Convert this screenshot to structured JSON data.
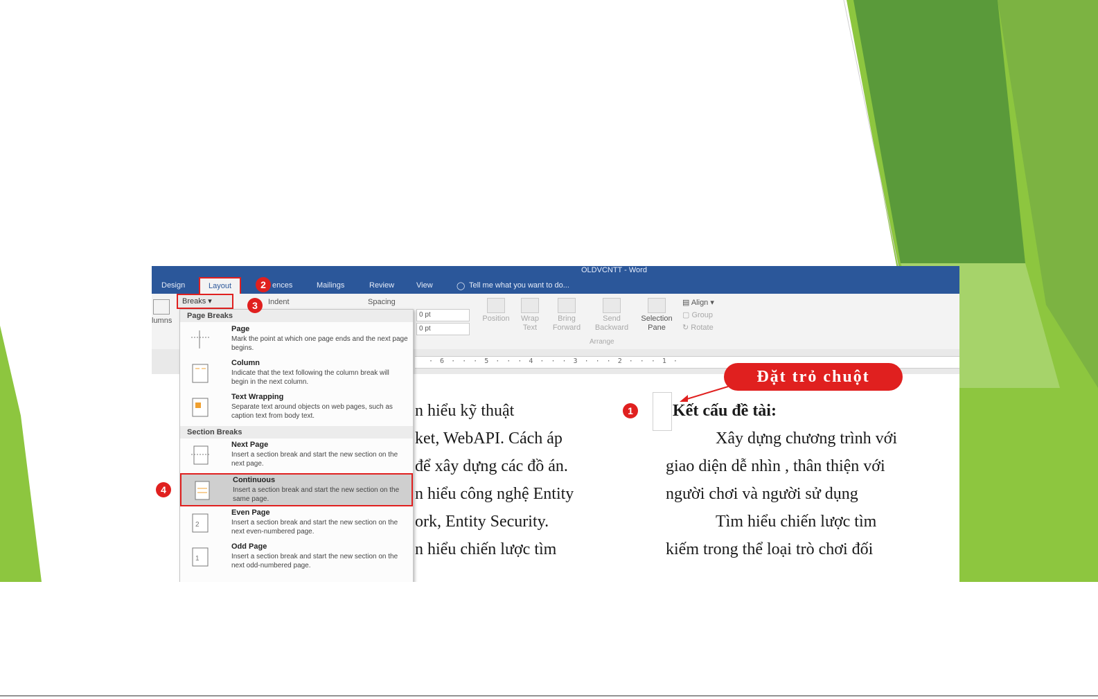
{
  "window_title": "OLDVCNTT - Word",
  "tabs": [
    "Design",
    "Layout",
    "ences",
    "Mailings",
    "Review",
    "View"
  ],
  "tell_me": "Tell me what you want to do...",
  "ribbon": {
    "columns_label": "lumns",
    "breaks_button": "Breaks",
    "indent_label": "Indent",
    "spacing_label": "Spacing",
    "spacing_before": "0 pt",
    "spacing_after": "0 pt",
    "position": "Position",
    "wrap_text": "Wrap Text",
    "bring_forward": "Bring Forward",
    "send_backward": "Send Backward",
    "selection_pane": "Selection Pane",
    "align": "Align",
    "group": "Group",
    "rotate": "Rotate",
    "arrange_group": "Arrange"
  },
  "ruler_numbers": "· 6 · · · 5 · · · 4 · · · 3 · · · 2 · · · 1 ·",
  "menu": {
    "page_breaks_header": "Page Breaks",
    "section_breaks_header": "Section Breaks",
    "items": [
      {
        "title": "Page",
        "desc": "Mark the point at which one page ends and the next page begins."
      },
      {
        "title": "Column",
        "desc": "Indicate that the text following the column break will begin in the next column."
      },
      {
        "title": "Text Wrapping",
        "desc": "Separate text around objects on web pages, such as caption text from body text."
      },
      {
        "title": "Next Page",
        "desc": "Insert a section break and start the new section on the next page."
      },
      {
        "title": "Continuous",
        "desc": "Insert a section break and start the new section on the same page."
      },
      {
        "title": "Even Page",
        "desc": "Insert a section break and start the new section on the next even-numbered page."
      },
      {
        "title": "Odd Page",
        "desc": "Insert a section break and start the new section on the next odd-numbered page."
      }
    ]
  },
  "badges": {
    "one": "1",
    "two": "2",
    "three": "3",
    "four": "4"
  },
  "callout": "Đặt trỏ chuột",
  "doc_left": [
    "n   hiểu   kỹ   thuật",
    "ket,  WebAPI.  Cách  áp",
    "để xây dựng các đồ án.",
    "n hiểu công nghệ Entity",
    "ork, Entity Security.",
    "n  hiểu  chiến  lược  tìm"
  ],
  "doc_right": {
    "heading": "Kết cấu đề tài:",
    "lines": [
      "Xây dựng chương trình với",
      "giao diện dễ nhìn , thân thiện với",
      "người chơi và người sử dụng",
      "Tìm  hiểu  chiến  lược  tìm",
      "kiếm trong thể loại trò chơi đối"
    ]
  },
  "colors": {
    "accent": "#e0201f",
    "word_blue": "#2b579a",
    "green_light": "#8dc63f",
    "green_dark": "#4e8a2c"
  }
}
